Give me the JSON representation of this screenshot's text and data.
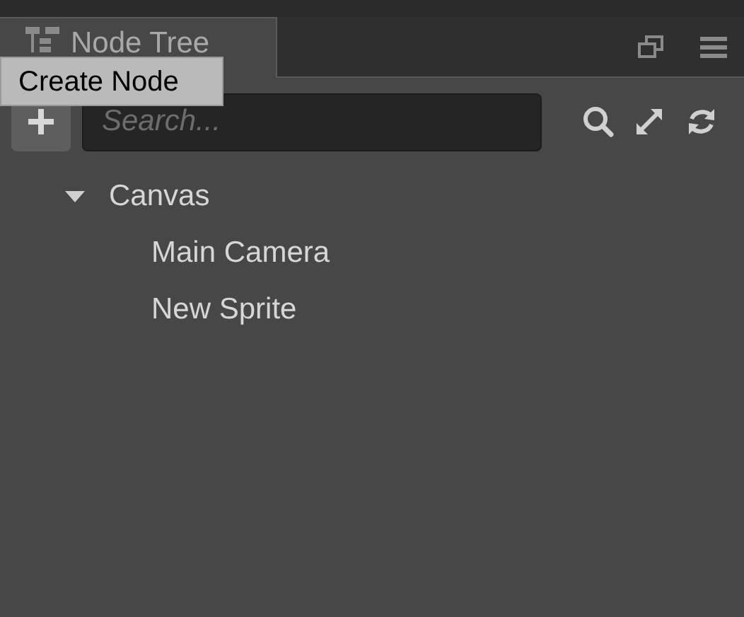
{
  "tab": {
    "title": "Node Tree"
  },
  "tooltip": {
    "text": "Create Node"
  },
  "search": {
    "placeholder": "Search..."
  },
  "tree": [
    {
      "name": "Canvas",
      "expanded": true,
      "children": [
        {
          "name": "Main Camera"
        },
        {
          "name": "New Sprite"
        }
      ]
    }
  ]
}
